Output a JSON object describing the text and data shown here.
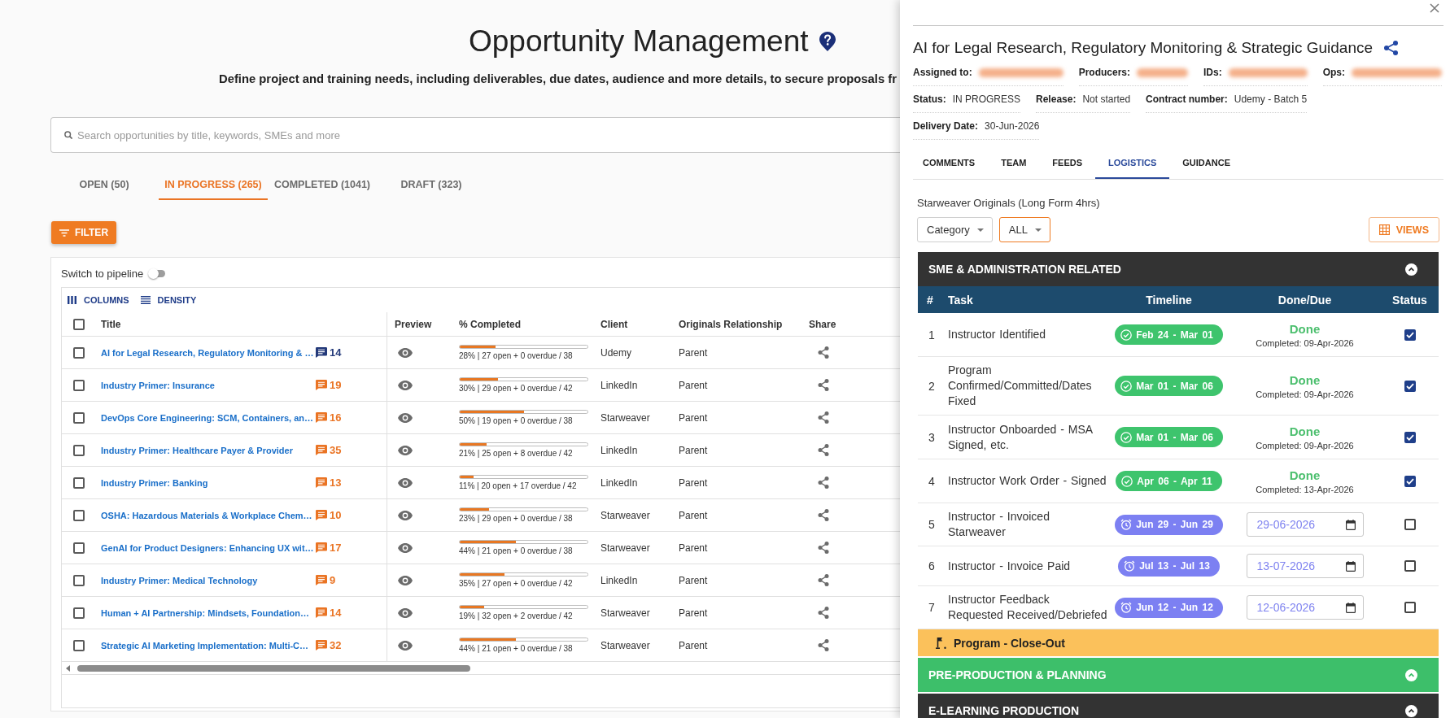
{
  "page": {
    "title": "Opportunity Management",
    "subtitle": "Define project and training needs, including deliverables, due dates, audience and more details, to secure proposals fr"
  },
  "search": {
    "placeholder": "Search opportunities by title, keywords, SMEs and more"
  },
  "tabs": [
    {
      "label": "OPEN (50)",
      "selected": false
    },
    {
      "label": "IN PROGRESS (265)",
      "selected": true
    },
    {
      "label": "COMPLETED (1041)",
      "selected": false
    },
    {
      "label": "DRAFT (323)",
      "selected": false
    }
  ],
  "filter_button": {
    "label": "FILTER"
  },
  "pipeline_switch": {
    "label": "Switch to pipeline",
    "on": false
  },
  "grid_toolbar": [
    {
      "kind": "columns",
      "label": "COLUMNS"
    },
    {
      "kind": "density",
      "label": "DENSITY"
    }
  ],
  "table": {
    "select_all": false,
    "columns": [
      "Title",
      "Preview",
      "% Completed",
      "Client",
      "Originals Relationship",
      "Share"
    ],
    "rows": [
      {
        "selected": false,
        "title": "AI for Legal Research, Regulatory Monitoring & …",
        "comments": {
          "count": "14",
          "unread": false
        },
        "progress": {
          "level": 0.28,
          "text": "28% | 27 open + 0 overdue / 38"
        },
        "client": "Udemy",
        "relationship": "Parent"
      },
      {
        "selected": false,
        "title": "Industry Primer: Insurance",
        "comments": {
          "count": "19",
          "unread": true
        },
        "progress": {
          "level": 0.3,
          "text": "30% | 29 open + 0 overdue / 42"
        },
        "client": "LinkedIn",
        "relationship": "Parent"
      },
      {
        "selected": false,
        "title": "DevOps Core Engineering: SCM, Containers, an…",
        "comments": {
          "count": "16",
          "unread": true
        },
        "progress": {
          "level": 0.5,
          "text": "50% | 19 open + 0 overdue / 38"
        },
        "client": "Starweaver",
        "relationship": "Parent"
      },
      {
        "selected": false,
        "title": "Industry Primer: Healthcare Payer & Provider",
        "comments": {
          "count": "35",
          "unread": true
        },
        "progress": {
          "level": 0.21,
          "text": "21% | 25 open + 8 overdue / 42"
        },
        "client": "LinkedIn",
        "relationship": "Parent"
      },
      {
        "selected": false,
        "title": "Industry Primer: Banking",
        "comments": {
          "count": "13",
          "unread": true
        },
        "progress": {
          "level": 0.11,
          "text": "11% | 20 open + 17 overdue / 42"
        },
        "client": "LinkedIn",
        "relationship": "Parent"
      },
      {
        "selected": false,
        "title": "OSHA: Hazardous Materials & Workplace Chem…",
        "comments": {
          "count": "10",
          "unread": true
        },
        "progress": {
          "level": 0.23,
          "text": "23% | 29 open + 0 overdue / 38"
        },
        "client": "Starweaver",
        "relationship": "Parent"
      },
      {
        "selected": false,
        "title": "GenAI for Product Designers: Enhancing UX wit…",
        "comments": {
          "count": "17",
          "unread": true
        },
        "progress": {
          "level": 0.44,
          "text": "44% | 21 open + 0 overdue / 38"
        },
        "client": "Starweaver",
        "relationship": "Parent"
      },
      {
        "selected": false,
        "title": "Industry Primer: Medical Technology",
        "comments": {
          "count": "9",
          "unread": true
        },
        "progress": {
          "level": 0.35,
          "text": "35% | 27 open + 0 overdue / 42"
        },
        "client": "LinkedIn",
        "relationship": "Parent"
      },
      {
        "selected": false,
        "title": "Human + AI Partnership: Mindsets, Foundation…",
        "comments": {
          "count": "14",
          "unread": true
        },
        "progress": {
          "level": 0.19,
          "text": "19% | 32 open + 2 overdue / 42"
        },
        "client": "Starweaver",
        "relationship": "Parent"
      },
      {
        "selected": false,
        "title": "Strategic AI Marketing Implementation: Multi-C…",
        "comments": {
          "count": "32",
          "unread": true
        },
        "progress": {
          "level": 0.44,
          "text": "44% | 21 open + 0 overdue / 38"
        },
        "client": "Starweaver",
        "relationship": "Parent"
      }
    ]
  },
  "drawer": {
    "title": "AI for Legal Research, Regulatory Monitoring & Strategic Guidance",
    "field_rows": [
      {
        "fields": [
          {
            "label": "Assigned to:",
            "redacted": true
          },
          {
            "label": "Producers:",
            "redacted": true
          },
          {
            "label": "IDs:",
            "redacted": true
          },
          {
            "label": "Ops:",
            "redacted": true
          }
        ]
      },
      {
        "fields": [
          {
            "label": "Status:",
            "redacted": false,
            "value": "IN PROGRESS"
          },
          {
            "label": "Release:",
            "redacted": false,
            "value": "Not started"
          },
          {
            "label": "Contract number:",
            "redacted": false,
            "value": "Udemy - Batch 5"
          }
        ]
      },
      {
        "fields": [
          {
            "label": "Delivery Date:",
            "redacted": false,
            "value": "30-Jun-2026"
          }
        ]
      }
    ],
    "tabs": [
      {
        "label": "COMMENTS",
        "selected": false
      },
      {
        "label": "TEAM",
        "selected": false
      },
      {
        "label": "FEEDS",
        "selected": false
      },
      {
        "label": "LOGISTICS",
        "selected": true
      },
      {
        "label": "GUIDANCE",
        "selected": false
      }
    ],
    "program": "Starweaver Originals (Long Form 4hrs)",
    "dropdowns": [
      {
        "label": "Category",
        "active": false
      },
      {
        "label": "ALL",
        "active": true
      }
    ],
    "views_button": {
      "label": "VIEWS"
    },
    "sections": [
      {
        "title": "SME & ADMINISTRATION RELATED",
        "color": "#333333",
        "expanded": true,
        "columns": [
          "#",
          "Task",
          "Timeline",
          "Done/Due",
          "Status"
        ],
        "tasks": [
          {
            "number": "1",
            "task": "Instructor Identified",
            "timeline": "Feb 24 - Mar 01",
            "done": true,
            "done_label": "Done",
            "completed": "Completed: 09-Apr-2026"
          },
          {
            "number": "2",
            "task": "Program Confirmed/Committed/Dates Fixed",
            "timeline": "Mar 01 - Mar 06",
            "done": true,
            "done_label": "Done",
            "completed": "Completed: 09-Apr-2026"
          },
          {
            "number": "3",
            "task": "Instructor Onboarded - MSA Signed, etc.",
            "timeline": "Mar 01 - Mar 06",
            "done": true,
            "done_label": "Done",
            "completed": "Completed: 09-Apr-2026"
          },
          {
            "number": "4",
            "task": "Instructor Work Order - Signed",
            "timeline": "Apr 06 - Apr 11",
            "done": true,
            "done_label": "Done",
            "completed": "Completed: 13-Apr-2026"
          },
          {
            "number": "5",
            "task": "Instructor - Invoiced Starweaver",
            "timeline": "Jun 29 - Jun 29",
            "done": false,
            "due_date": "29-06-2026"
          },
          {
            "number": "6",
            "task": "Instructor - Invoice Paid",
            "timeline": "Jul 13 - Jul 13",
            "done": false,
            "due_date": "13-07-2026"
          },
          {
            "number": "7",
            "task": "Instructor Feedback Requested Received/Debriefed",
            "timeline": "Jun 12 - Jun 12",
            "done": false,
            "due_date": "12-06-2026"
          }
        ],
        "milestone": {
          "label": "Program - Close-Out"
        }
      },
      {
        "title": "PRE-PRODUCTION & PLANNING",
        "color": "#3dbf6a",
        "expanded": false
      },
      {
        "title": "E-LEARNING PRODUCTION",
        "color": "#333333",
        "expanded": false
      }
    ]
  }
}
